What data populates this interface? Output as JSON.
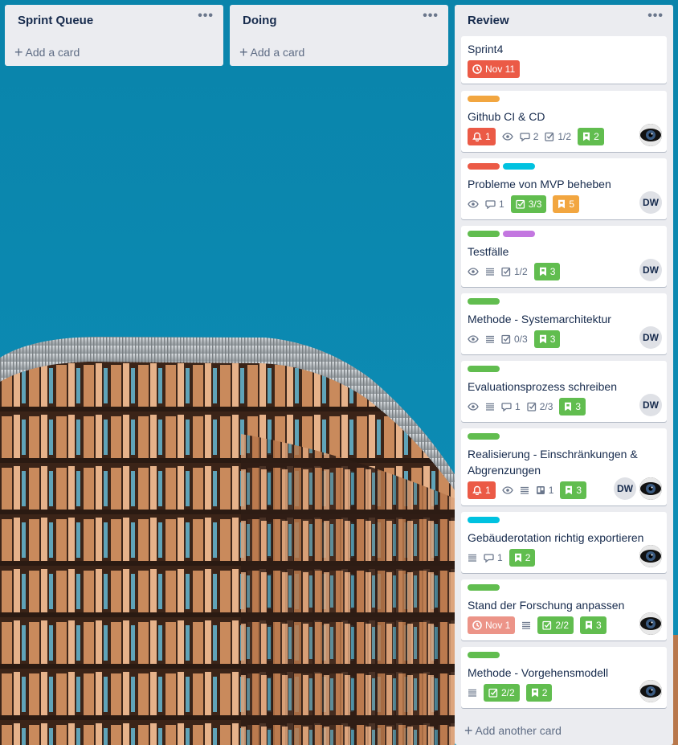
{
  "lists": [
    {
      "title": "Sprint Queue",
      "add_label": "Add a card"
    },
    {
      "title": "Doing",
      "add_label": "Add a card"
    },
    {
      "title": "Review",
      "add_label": "Add another card"
    }
  ],
  "menu_glyph": "•••",
  "cards": [
    {
      "title": "Sprint4",
      "due": "Nov 11"
    },
    {
      "title": "Github CI & CD",
      "notify": "1",
      "comments": "2",
      "checklist": "1/2",
      "attachments": "2"
    },
    {
      "title": "Probleme von MVP beheben",
      "comments": "1",
      "checklist": "3/3",
      "attachments": "5",
      "member": "DW"
    },
    {
      "title": "Testfälle",
      "checklist": "1/2",
      "attachments": "3",
      "member": "DW"
    },
    {
      "title": "Methode - Systemarchitektur",
      "checklist": "0/3",
      "attachments": "3",
      "member": "DW"
    },
    {
      "title": "Evaluationsprozess schreiben",
      "comments": "1",
      "checklist": "2/3",
      "attachments": "3",
      "member": "DW"
    },
    {
      "title": "Realisierung - Einschränkungen & Abgrenzungen",
      "notify": "1",
      "trello": "1",
      "attachments": "3",
      "member": "DW"
    },
    {
      "title": "Gebäuderotation richtig exportieren",
      "comments": "1",
      "attachments": "2"
    },
    {
      "title": "Stand der Forschung anpassen",
      "due": "Nov 1",
      "checklist": "2/2",
      "attachments": "3"
    },
    {
      "title": "Methode - Vorgehensmodell",
      "checklist": "2/2",
      "attachments": "2"
    }
  ],
  "colors": {
    "sky": "#0b86ad",
    "label_orange": "#f2a640",
    "label_red": "#eb5a46",
    "label_cyan": "#00c2e0",
    "label_green": "#61bd4f",
    "label_purple": "#c377e0",
    "badge_red": "#eb5a46",
    "badge_green": "#61bd4f",
    "badge_orange": "#f2a640"
  }
}
